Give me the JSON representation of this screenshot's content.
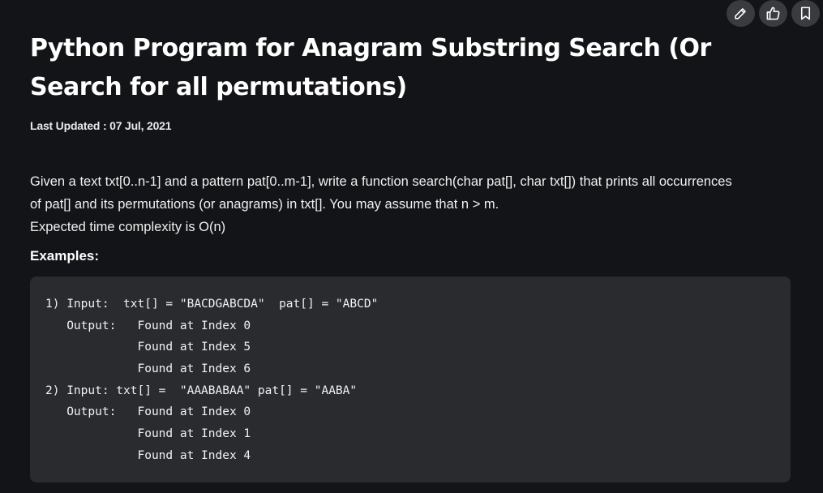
{
  "toolbar": {
    "icons": [
      "pencil-icon",
      "thumbs-up-icon",
      "bookmark-icon"
    ]
  },
  "article": {
    "title": "Python Program for Anagram Substring Search (Or Search for all permutations)",
    "last_updated": "Last Updated : 07 Jul, 2021",
    "paragraph_lines": [
      "Given a text txt[0..n-1] and a pattern pat[0..m-1], write a function search(char pat[], char txt[]) that prints all occurrences",
      "of pat[] and its permutations (or anagrams) in txt[]. You may assume that n > m.",
      "Expected time complexity is O(n)"
    ],
    "examples_heading": "Examples:",
    "code_lines": [
      "1) Input:  txt[] = \"BACDGABCDA\"  pat[] = \"ABCD\"",
      "   Output:   Found at Index 0",
      "             Found at Index 5",
      "             Found at Index 6",
      "2) Input: txt[] =  \"AAABABAA\" pat[] = \"AABA\"",
      "   Output:   Found at Index 0",
      "             Found at Index 1",
      "             Found at Index 4"
    ]
  },
  "colors": {
    "background": "#131417",
    "code_background": "#2a2b2e",
    "icon_button": "#3a3b3f",
    "text": "#ffffff"
  }
}
